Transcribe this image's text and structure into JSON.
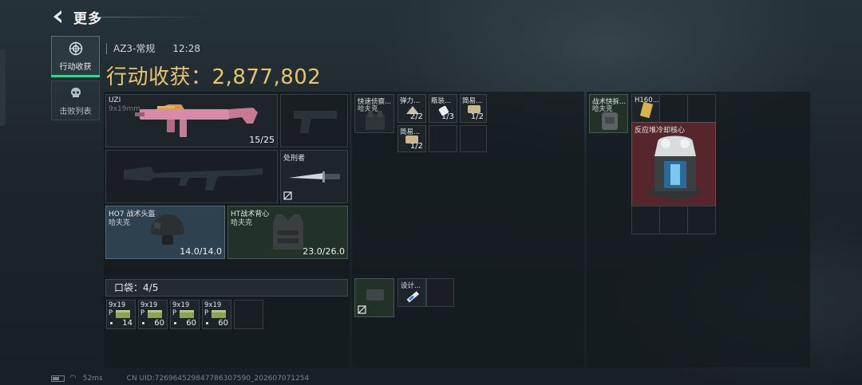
{
  "header": {
    "title": "更多"
  },
  "sidebar": {
    "tabs": [
      {
        "label": "行动收获",
        "active": true,
        "icon": "target-icon"
      },
      {
        "label": "击败列表",
        "active": false,
        "icon": "skull-icon"
      }
    ]
  },
  "match": {
    "map": "AZ3-常规",
    "time": "12:28"
  },
  "gain": {
    "label": "行动收获：",
    "value": "2,877,802",
    "color": "#e8c46a"
  },
  "loadout": {
    "primary": {
      "name": "UZI",
      "caliber": "9x19mm",
      "ammo": "15/25"
    },
    "secondary": {
      "name": "",
      "ammo": ""
    },
    "melee": {
      "name": "处刑者"
    },
    "helmet": {
      "name": "HO7 战术头盔",
      "brand": "哈夫克",
      "durability": "14.0/14.0"
    },
    "armor": {
      "name": "HT战术背心",
      "brand": "哈夫克",
      "durability": "23.0/26.0"
    },
    "pocket": {
      "label": "口袋：",
      "count": "4/5"
    },
    "ammo_slots": [
      {
        "type": "9x19",
        "sub": "P",
        "count": "14"
      },
      {
        "type": "9x19",
        "sub": "P",
        "count": "60"
      },
      {
        "type": "9x19",
        "sub": "P",
        "count": "60"
      },
      {
        "type": "9x19",
        "sub": "P",
        "count": "60"
      }
    ]
  },
  "chest_rig": {
    "name": "快速侦察...",
    "brand": "哈夫克",
    "items": [
      {
        "name": "弹力...",
        "count": "2/2"
      },
      {
        "name": "瓶装...",
        "count": "1/3"
      },
      {
        "name": "简易...",
        "count": "1/2"
      },
      {
        "name": "简易...",
        "count": "1/2"
      }
    ]
  },
  "case": {
    "name": "设计..."
  },
  "backpack": {
    "name": "战术快拆...",
    "brand": "哈夫克",
    "items": [
      {
        "name": "H160..."
      },
      {
        "name": "反应堆冷却核心"
      }
    ]
  },
  "status": {
    "ping": "52ms",
    "uid": "CN UID:726964529847786307590_202607071254"
  }
}
